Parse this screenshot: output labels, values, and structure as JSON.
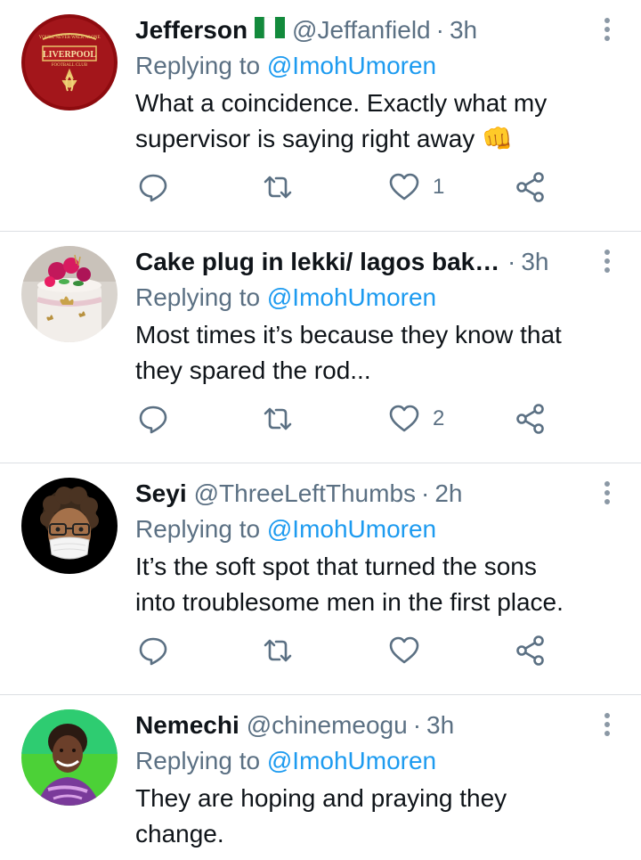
{
  "tweets": [
    {
      "name": "Jefferson",
      "has_flag": true,
      "handle": "@Jeffanfield",
      "dot": "·",
      "time": "3h",
      "replying_prefix": "Replying to",
      "replying_to": "@ImohUmoren",
      "text": "What a coincidence. Exactly what my\nsupervisor is saying right away 👊",
      "likes": "1",
      "avatar_text_top": "YOU'LL NEVER WALK ALONE",
      "avatar_text_main": "LIVERPOOL",
      "avatar_text_sub": "FOOTBALL CLUB"
    },
    {
      "name": "Cake plug in lekki/ lagos baker …",
      "handle": "",
      "dot": "·",
      "time": "3h",
      "replying_prefix": "Replying to",
      "replying_to": "@ImohUmoren",
      "text": "Most times it’s because they know that\nthey spared the rod...",
      "likes": "2"
    },
    {
      "name": "Seyi",
      "handle": "@ThreeLeftThumbs",
      "dot": "·",
      "time": "2h",
      "replying_prefix": "Replying to",
      "replying_to": "@ImohUmoren",
      "text": "It’s the soft spot that turned the sons\ninto troublesome men in the first place.",
      "likes": ""
    },
    {
      "name": "Nemechi",
      "handle": "@chinemeogu",
      "dot": "·",
      "time": "3h",
      "replying_prefix": "Replying to",
      "replying_to": "@ImohUmoren",
      "text": "They are hoping and praying they\nchange."
    }
  ],
  "colors": {
    "text": "#0f1419",
    "secondary": "#5b7083",
    "accent": "#1d9bf0",
    "divider": "#dcdfe3"
  },
  "icons": {
    "reply": "speech-bubble",
    "retweet": "retweet-arrows",
    "like": "heart",
    "share": "share-nodes",
    "more": "vertical-ellipsis"
  }
}
